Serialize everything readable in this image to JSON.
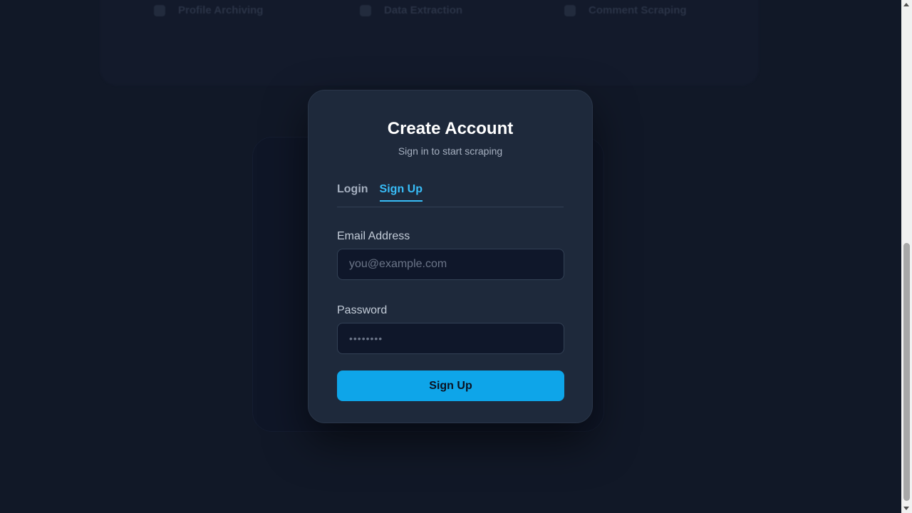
{
  "background": {
    "features": [
      {
        "label": "Profile Archiving",
        "icon": "archive-icon"
      },
      {
        "label": "Data Extraction",
        "icon": "database-icon"
      },
      {
        "label": "Comment Scraping",
        "icon": "comment-icon"
      }
    ]
  },
  "modal": {
    "title": "Create Account",
    "subtitle": "Sign in to start scraping",
    "tabs": [
      {
        "label": "Login",
        "active": false
      },
      {
        "label": "Sign Up",
        "active": true
      }
    ],
    "email": {
      "label": "Email Address",
      "placeholder": "you@example.com",
      "value": ""
    },
    "password": {
      "label": "Password",
      "placeholder": "••••••••",
      "value": ""
    },
    "submit_label": "Sign Up"
  },
  "colors": {
    "accent": "#38bdf8",
    "button": "#0ea5e9",
    "modal_bg": "#1e293b",
    "page_bg": "#0f172a"
  }
}
